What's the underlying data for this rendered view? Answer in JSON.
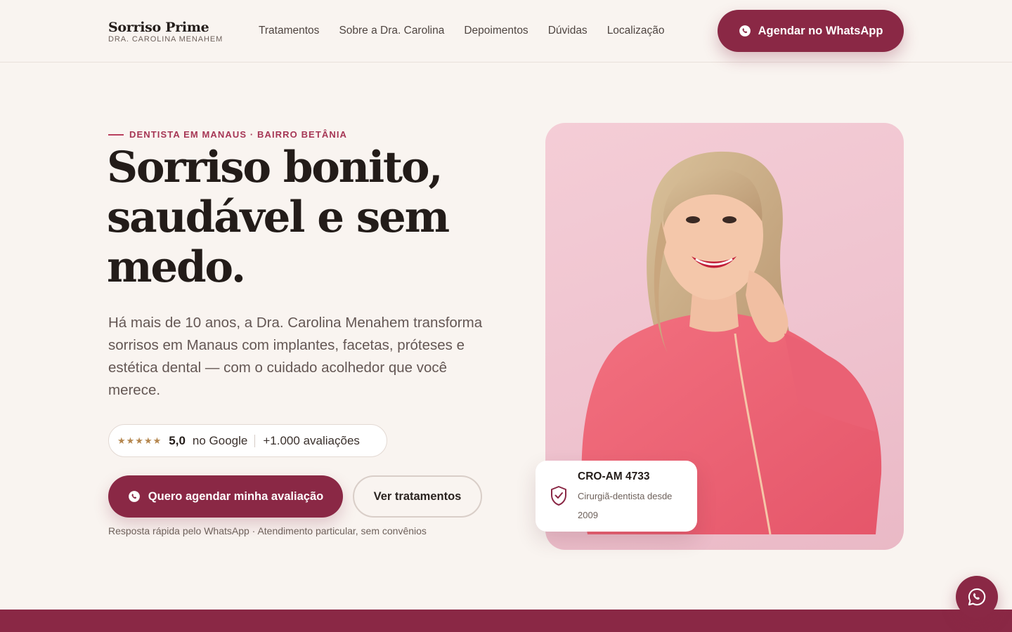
{
  "header": {
    "brand_name": "Sorriso Prime",
    "brand_sub": "DRA. CAROLINA MENAHEM",
    "nav": [
      {
        "label": "Tratamentos"
      },
      {
        "label": "Sobre a Dra. Carolina"
      },
      {
        "label": "Depoimentos"
      },
      {
        "label": "Dúvidas"
      },
      {
        "label": "Localização"
      }
    ],
    "cta_label": "Agendar no WhatsApp"
  },
  "hero": {
    "eyebrow": "DENTISTA EM MANAUS · BAIRRO BETÂNIA",
    "title_line1": "Sorriso bonito,",
    "title_line2": "saudável e sem",
    "title_line3": "medo.",
    "description": "Há mais de 10 anos, a Dra. Carolina Menahem transforma sorrisos em Manaus com implantes, facetas, próteses e estética dental — com o cuidado acolhedor que você merece.",
    "rating": {
      "stars": "★★★★★",
      "score": "5,0",
      "source": "no Google",
      "count": "+1.000 avaliações"
    },
    "primary_cta": "Quero agendar minha avaliação",
    "secondary_cta": "Ver tratamentos",
    "note": "Resposta rápida pelo WhatsApp · Atendimento particular, sem convênios"
  },
  "credential": {
    "title": "CRO-AM 4733",
    "subtitle": "Cirurgiã-dentista desde 2009",
    "icon": "shield-check-icon"
  },
  "colors": {
    "brand": "#8a2845",
    "accent": "#a63655",
    "background": "#f9f4f0",
    "star": "#b5874f"
  }
}
